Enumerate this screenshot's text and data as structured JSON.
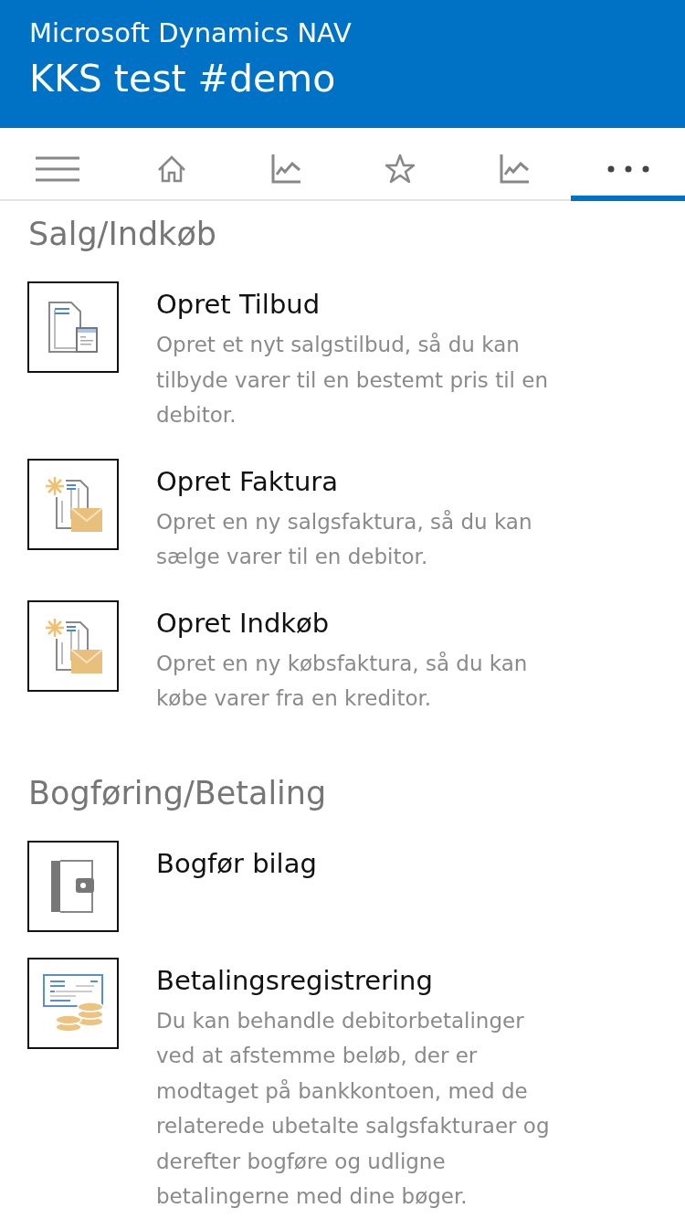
{
  "header": {
    "app_name": "Microsoft Dynamics NAV",
    "company": "KKS test #demo"
  },
  "nav_tabs": [
    {
      "kind": "menu",
      "selected": false
    },
    {
      "kind": "home",
      "selected": false
    },
    {
      "kind": "chart",
      "selected": false
    },
    {
      "kind": "star",
      "selected": false
    },
    {
      "kind": "chart",
      "selected": false
    },
    {
      "kind": "more",
      "selected": true
    }
  ],
  "sections": [
    {
      "title": "Salg/Indkøb",
      "actions": [
        {
          "kind": "quote",
          "title": "Opret Tilbud",
          "description": "Opret et nyt salgstilbud, så du kan tilbyde varer til en bestemt pris til en debitor."
        },
        {
          "kind": "invoice",
          "title": "Opret Faktura",
          "description": "Opret en ny salgsfaktura, så du kan sælge varer til en debitor."
        },
        {
          "kind": "invoice",
          "title": "Opret Indkøb",
          "description": "Opret en ny købsfaktura, så du kan købe varer fra en kreditor."
        }
      ]
    },
    {
      "title": "Bogføring/Betaling",
      "actions": [
        {
          "kind": "wallet",
          "title": "Bogfør bilag"
        },
        {
          "kind": "payment",
          "title": "Betalingsregistrering",
          "description": "Du kan behandle debitorbetalinger ved at afstemme beløb, der er modtaget på bankkontoen, med de relaterede ubetalte salgsfakturaer og derefter bogføre og udligne betalingerne med dine bøger."
        }
      ]
    }
  ]
}
